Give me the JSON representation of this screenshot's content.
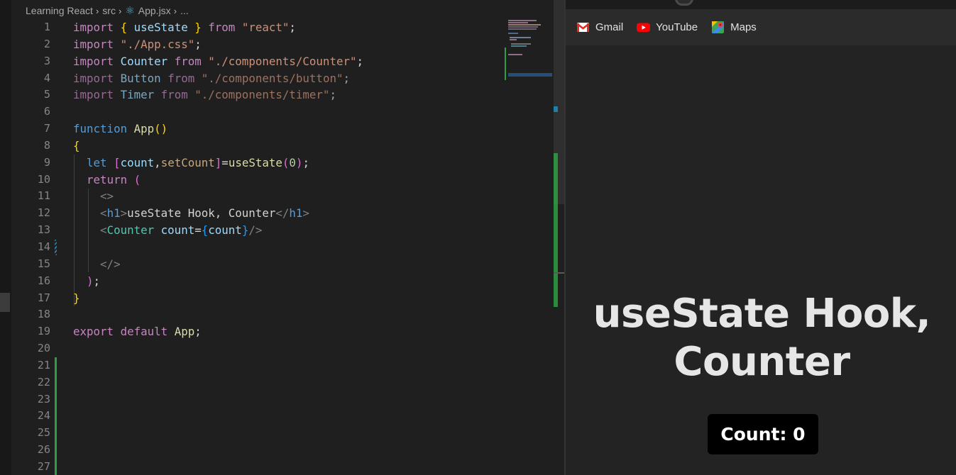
{
  "editor": {
    "breadcrumb": [
      "Learning React",
      "src",
      "App.jsx",
      "..."
    ],
    "line_numbers": [
      "1",
      "2",
      "3",
      "4",
      "5",
      "6",
      "7",
      "8",
      "9",
      "10",
      "11",
      "12",
      "13",
      "14",
      "15",
      "16",
      "17",
      "18",
      "19",
      "20",
      "21",
      "22",
      "23",
      "24",
      "25",
      "26",
      "27"
    ],
    "code": {
      "l1": [
        "import",
        "{",
        "useState",
        "}",
        "from",
        "\"react\"",
        ";"
      ],
      "l2": [
        "import",
        "\"./App.css\"",
        ";"
      ],
      "l3": [
        "import",
        "Counter",
        "from",
        "\"./components/Counter\"",
        ";"
      ],
      "l4": [
        "import",
        "Button",
        "from",
        "\"./components/button\"",
        ";"
      ],
      "l5": [
        "import",
        "Timer",
        "from",
        "\"./components/timer\"",
        ";"
      ],
      "l7": [
        "function",
        "App",
        "(",
        ")"
      ],
      "l8": [
        "{"
      ],
      "l9": [
        "let",
        "[",
        "count",
        ",",
        "setCount",
        "]",
        "=",
        "useState",
        "(",
        "0",
        ")",
        ";"
      ],
      "l10": [
        "return",
        "("
      ],
      "l11": [
        "<>"
      ],
      "l12": [
        "<",
        "h1",
        ">",
        "useState Hook, Counter",
        "</",
        "h1",
        ">"
      ],
      "l13": [
        "<",
        "Counter",
        "count",
        "=",
        "{",
        "count",
        "}",
        "/>"
      ],
      "l15": [
        "</>"
      ],
      "l16": [
        ")",
        ";"
      ],
      "l17": [
        "}"
      ],
      "l19": [
        "export",
        "default",
        "App",
        ";"
      ]
    }
  },
  "browser": {
    "bookmarks": [
      {
        "label": "Gmail",
        "icon": "gmail-icon"
      },
      {
        "label": "YouTube",
        "icon": "youtube-icon"
      },
      {
        "label": "Maps",
        "icon": "maps-icon"
      }
    ],
    "page": {
      "heading": "useState Hook, Counter",
      "count_text": "Count: 0"
    }
  },
  "colors": {
    "editor_bg": "#1f1f1f",
    "keyword": "#c586c0",
    "string": "#ce9178",
    "variable": "#9cdcfe",
    "function": "#dcdcaa",
    "component": "#4ec9b0",
    "git_added": "#2ea043",
    "browser_bg": "#232323"
  }
}
